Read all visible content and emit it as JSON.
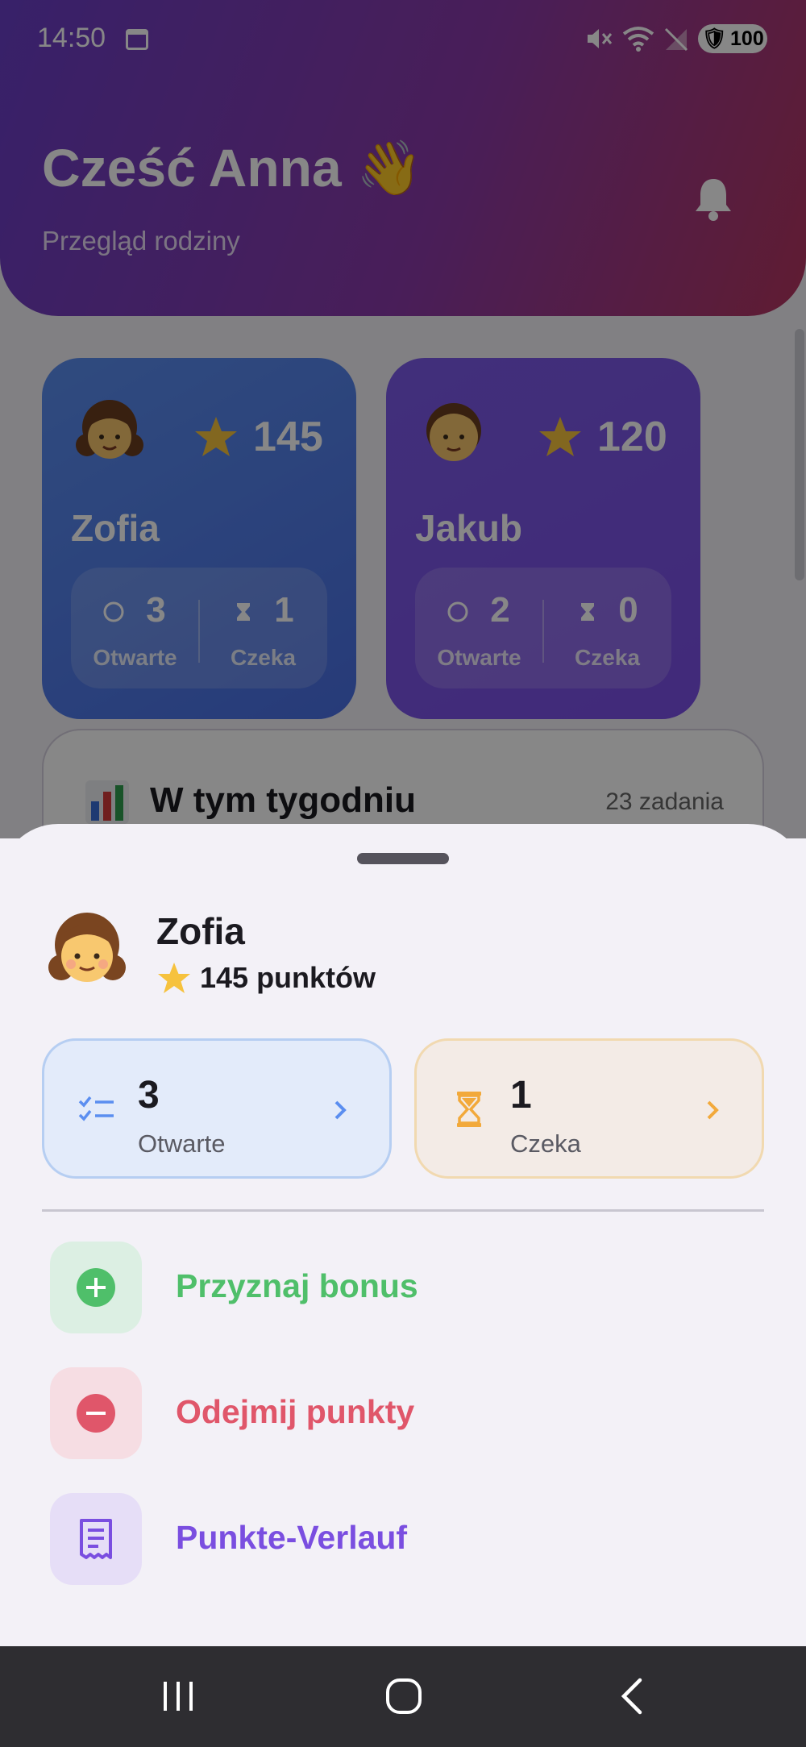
{
  "status_bar": {
    "time": "14:50",
    "battery": "100"
  },
  "header": {
    "greeting": "Cześć Anna 👋",
    "subtitle": "Przegląd rodziny"
  },
  "kids": [
    {
      "name": "Zofia",
      "points": "145",
      "open_count": "3",
      "open_label": "Otwarte",
      "wait_count": "1",
      "wait_label": "Czeka"
    },
    {
      "name": "Jakub",
      "points": "120",
      "open_count": "2",
      "open_label": "Otwarte",
      "wait_count": "0",
      "wait_label": "Czeka"
    }
  ],
  "week": {
    "title": "W tym tygodniu",
    "count": "23 zadania"
  },
  "sheet": {
    "name": "Zofia",
    "points_text": "145 punktów",
    "open": {
      "count": "3",
      "label": "Otwarte"
    },
    "wait": {
      "count": "1",
      "label": "Czeka"
    },
    "actions": [
      {
        "label": "Przyznaj bonus",
        "color": "#4fbf6a",
        "icon": "plus-circle-icon"
      },
      {
        "label": "Odejmij punkty",
        "color": "#e0566a",
        "icon": "minus-circle-icon"
      },
      {
        "label": "Punkte-Verlauf",
        "color": "#7a4ee0",
        "icon": "receipt-icon"
      }
    ]
  },
  "colors": {
    "open_accent": "#5b8ef0",
    "wait_accent": "#f2a93b",
    "card_zofia": "#5b8ef0",
    "card_jakub": "#7b4fe6"
  }
}
